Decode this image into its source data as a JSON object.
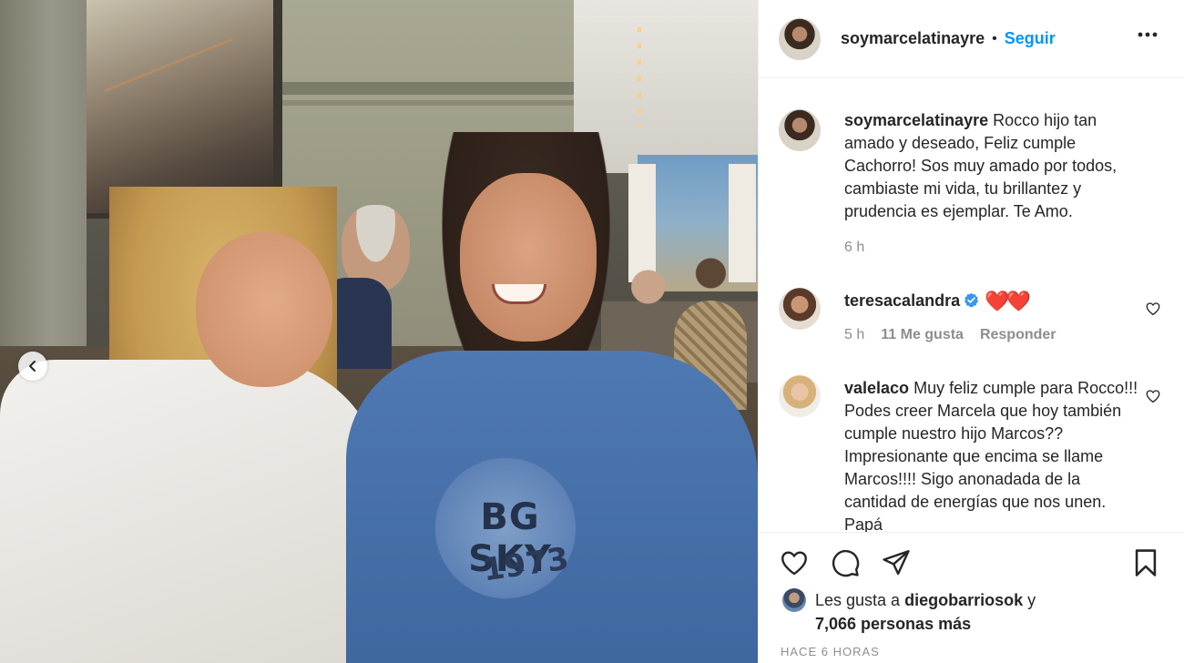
{
  "post": {
    "author": "soymarcelatinayre",
    "separator": "•",
    "follow_label": "Seguir",
    "more_icon": "more-horizontal-icon"
  },
  "photo": {
    "shirt_print_text": "BG SKY",
    "shirt_print_year": "1973"
  },
  "caption": {
    "username": "soymarcelatinayre",
    "text": "Rocco hijo tan amado y deseado, Feliz cumple Cachorro! Sos muy amado por todos, cambiaste mi vida, tu brillantez y prudencia es ejemplar. Te Amo.",
    "time": "6 h"
  },
  "comments": [
    {
      "username": "teresacalandra",
      "verified": true,
      "text": "❤️❤️",
      "time": "5 h",
      "likes": "11 Me gusta",
      "reply_label": "Responder"
    },
    {
      "username": "valelaco",
      "text": "Muy feliz cumple para Rocco!!! Podes creer Marcela que hoy también cumple nuestro hijo Marcos?? Impresionante que encima se llame Marcos!!!! Sigo anonadada de la cantidad de energías que nos unen. Papá"
    }
  ],
  "likes": {
    "prefix": "Les gusta a",
    "first_user": "diegobarriosok",
    "connector": "y",
    "others": "7,066 personas más"
  },
  "timestamp": "HACE 6 HORAS",
  "colors": {
    "link_blue": "#0095f6",
    "text": "#262626",
    "muted": "#8e8e8e",
    "heart_red": "#e0242b"
  }
}
